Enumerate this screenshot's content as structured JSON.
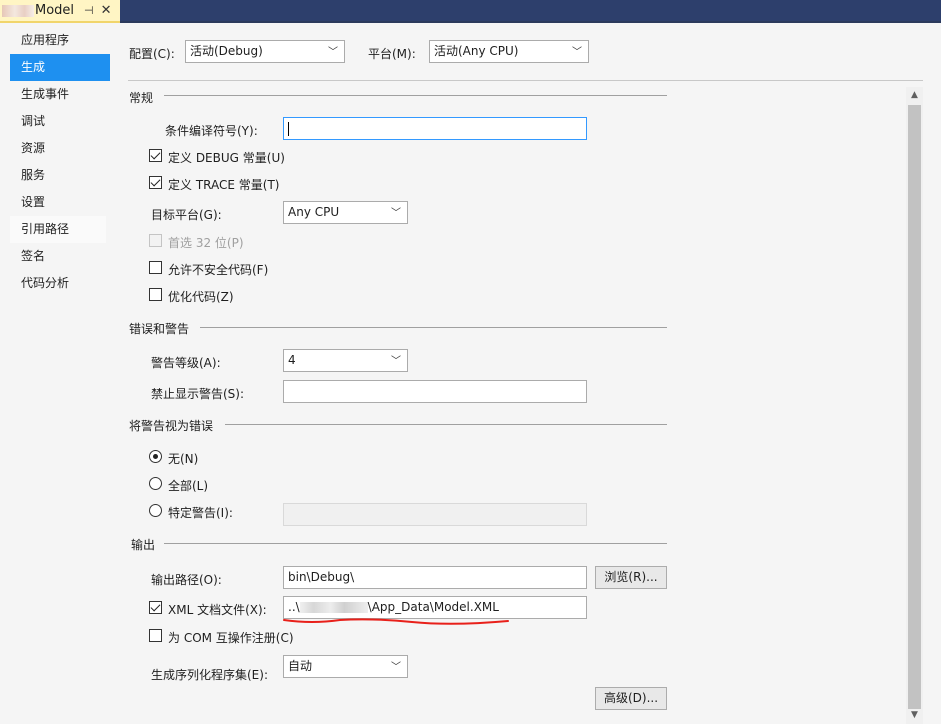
{
  "tab": {
    "title": "Model",
    "pin_glyph": "⊣",
    "close_glyph": "✕"
  },
  "sidebar": {
    "items": [
      {
        "label": "应用程序"
      },
      {
        "label": "生成"
      },
      {
        "label": "生成事件"
      },
      {
        "label": "调试"
      },
      {
        "label": "资源"
      },
      {
        "label": "服务"
      },
      {
        "label": "设置"
      },
      {
        "label": "引用路径"
      },
      {
        "label": "签名"
      },
      {
        "label": "代码分析"
      }
    ]
  },
  "config": {
    "config_label": "配置(C):",
    "config_value": "活动(Debug)",
    "platform_label": "平台(M):",
    "platform_value": "活动(Any CPU)"
  },
  "general": {
    "title": "常规",
    "conditional_symbols_label": "条件编译符号(Y):",
    "conditional_symbols_value": "",
    "define_debug_label": "定义 DEBUG 常量(U)",
    "define_trace_label": "定义 TRACE 常量(T)",
    "target_platform_label": "目标平台(G):",
    "target_platform_value": "Any CPU",
    "prefer32_label": "首选 32 位(P)",
    "allow_unsafe_label": "允许不安全代码(F)",
    "optimize_label": "优化代码(Z)"
  },
  "errors": {
    "title": "错误和警告",
    "warning_level_label": "警告等级(A):",
    "warning_level_value": "4",
    "suppress_label": "禁止显示警告(S):",
    "suppress_value": ""
  },
  "treat_warnings": {
    "title": "将警告视为错误",
    "none_label": "无(N)",
    "all_label": "全部(L)",
    "specific_label": "特定警告(I):",
    "specific_value": ""
  },
  "output": {
    "title": "输出",
    "path_label": "输出路径(O):",
    "path_value": "bin\\Debug\\",
    "browse_label": "浏览(R)...",
    "xml_label": "XML 文档文件(X):",
    "xml_prefix": "..\\",
    "xml_suffix": "\\App_Data\\Model.XML",
    "com_label": "为 COM 互操作注册(C)",
    "serialization_label": "生成序列化程序集(E):",
    "serialization_value": "自动",
    "advanced_label": "高级(D)..."
  },
  "colors": {
    "accent": "#1e90f0",
    "tab_bg": "#fff5c4",
    "annotation_red": "#e8201a"
  }
}
